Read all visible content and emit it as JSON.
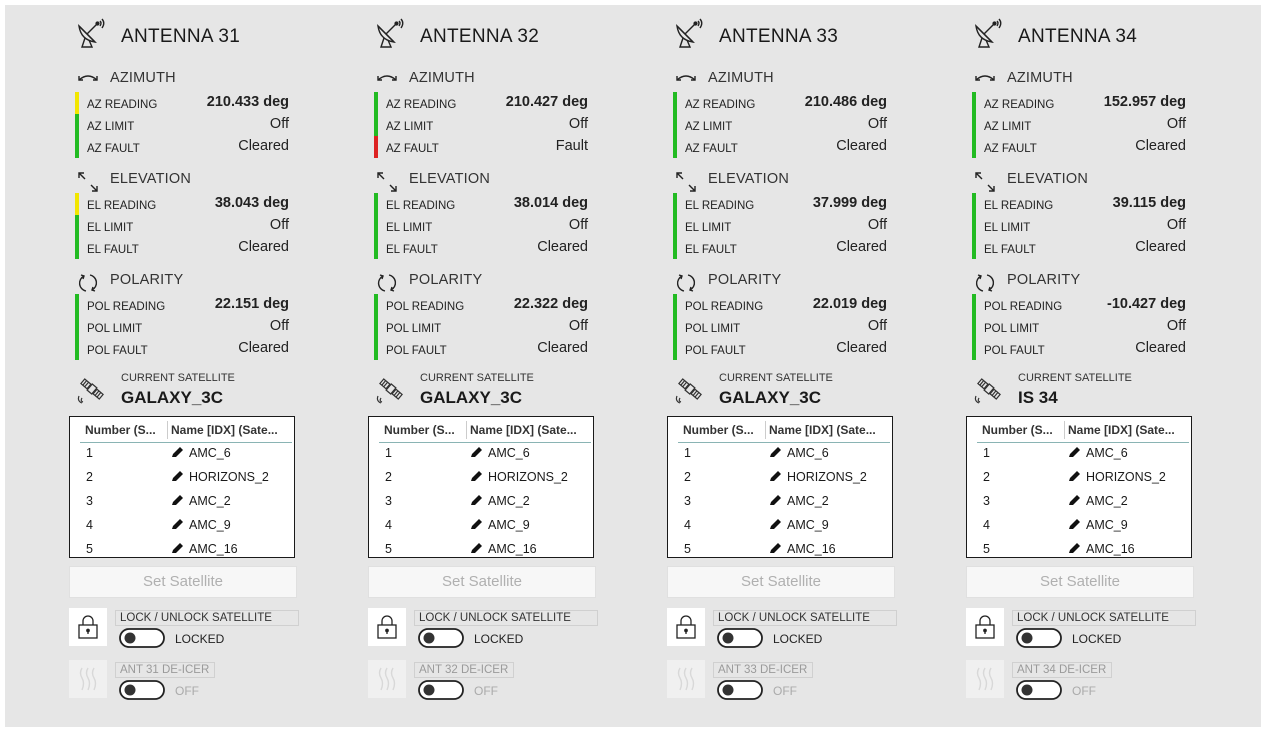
{
  "colors": {
    "ok": "#22bb22",
    "warn": "#f2e600",
    "fault": "#dd2222",
    "toggle_border": "#222222"
  },
  "icons": {
    "antenna": "satellite-dish-icon",
    "azimuth": "azimuth-arrows-icon",
    "elevation": "elevation-arrows-icon",
    "polarity": "polarity-rotate-icon",
    "satellite": "satellite-icon",
    "lock": "padlock-icon",
    "deicer": "heat-waves-icon",
    "pencil": "pencil-edit-icon"
  },
  "labels": {
    "azimuth": "AZIMUTH",
    "elevation": "ELEVATION",
    "polarity": "POLARITY",
    "az_reading": "AZ READING",
    "az_limit": "AZ LIMIT",
    "az_fault": "AZ FAULT",
    "el_reading": "EL READING",
    "el_limit": "EL LIMIT",
    "el_fault": "EL FAULT",
    "pol_reading": "POL READING",
    "pol_limit": "POL LIMIT",
    "pol_fault": "POL FAULT",
    "current_satellite": "CURRENT SATELLITE",
    "table_col_number": "Number (S...",
    "table_col_name": "Name [IDX] (Sate...",
    "set_satellite": "Set Satellite",
    "lock_unlock": "LOCK / UNLOCK SATELLITE"
  },
  "antennas": [
    {
      "title": "ANTENNA 31",
      "az": {
        "reading": "210.433 deg",
        "limit": "Off",
        "fault": "Cleared",
        "bars": [
          "warn",
          "ok",
          "ok"
        ]
      },
      "el": {
        "reading": "38.043 deg",
        "limit": "Off",
        "fault": "Cleared",
        "bars": [
          "warn",
          "ok",
          "ok"
        ]
      },
      "pol": {
        "reading": "22.151 deg",
        "limit": "Off",
        "fault": "Cleared",
        "bars": [
          "ok",
          "ok",
          "ok"
        ]
      },
      "current_satellite": "GALAXY_3C",
      "lock_state": "LOCKED",
      "deicer_label": "ANT 31 DE-ICER",
      "deicer_state": "OFF"
    },
    {
      "title": "ANTENNA 32",
      "az": {
        "reading": "210.427 deg",
        "limit": "Off",
        "fault": "Fault",
        "bars": [
          "ok",
          "ok",
          "fault"
        ]
      },
      "el": {
        "reading": "38.014 deg",
        "limit": "Off",
        "fault": "Cleared",
        "bars": [
          "ok",
          "ok",
          "ok"
        ]
      },
      "pol": {
        "reading": "22.322 deg",
        "limit": "Off",
        "fault": "Cleared",
        "bars": [
          "ok",
          "ok",
          "ok"
        ]
      },
      "current_satellite": "GALAXY_3C",
      "lock_state": "LOCKED",
      "deicer_label": "ANT 32 DE-ICER",
      "deicer_state": "OFF"
    },
    {
      "title": "ANTENNA 33",
      "az": {
        "reading": "210.486 deg",
        "limit": "Off",
        "fault": "Cleared",
        "bars": [
          "ok",
          "ok",
          "ok"
        ]
      },
      "el": {
        "reading": "37.999 deg",
        "limit": "Off",
        "fault": "Cleared",
        "bars": [
          "ok",
          "ok",
          "ok"
        ]
      },
      "pol": {
        "reading": "22.019 deg",
        "limit": "Off",
        "fault": "Cleared",
        "bars": [
          "ok",
          "ok",
          "ok"
        ]
      },
      "current_satellite": "GALAXY_3C",
      "lock_state": "LOCKED",
      "deicer_label": "ANT 33 DE-ICER",
      "deicer_state": "OFF"
    },
    {
      "title": "ANTENNA 34",
      "az": {
        "reading": "152.957 deg",
        "limit": "Off",
        "fault": "Cleared",
        "bars": [
          "ok",
          "ok",
          "ok"
        ]
      },
      "el": {
        "reading": "39.115 deg",
        "limit": "Off",
        "fault": "Cleared",
        "bars": [
          "ok",
          "ok",
          "ok"
        ]
      },
      "pol": {
        "reading": "-10.427 deg",
        "limit": "Off",
        "fault": "Cleared",
        "bars": [
          "ok",
          "ok",
          "ok"
        ]
      },
      "current_satellite": "IS 34",
      "lock_state": "LOCKED",
      "deicer_label": "ANT 34 DE-ICER",
      "deicer_state": "OFF"
    }
  ],
  "satellite_list": [
    {
      "number": "1",
      "name": "AMC_6"
    },
    {
      "number": "2",
      "name": "HORIZONS_2"
    },
    {
      "number": "3",
      "name": "AMC_2"
    },
    {
      "number": "4",
      "name": "AMC_9"
    },
    {
      "number": "5",
      "name": "AMC_16"
    }
  ]
}
